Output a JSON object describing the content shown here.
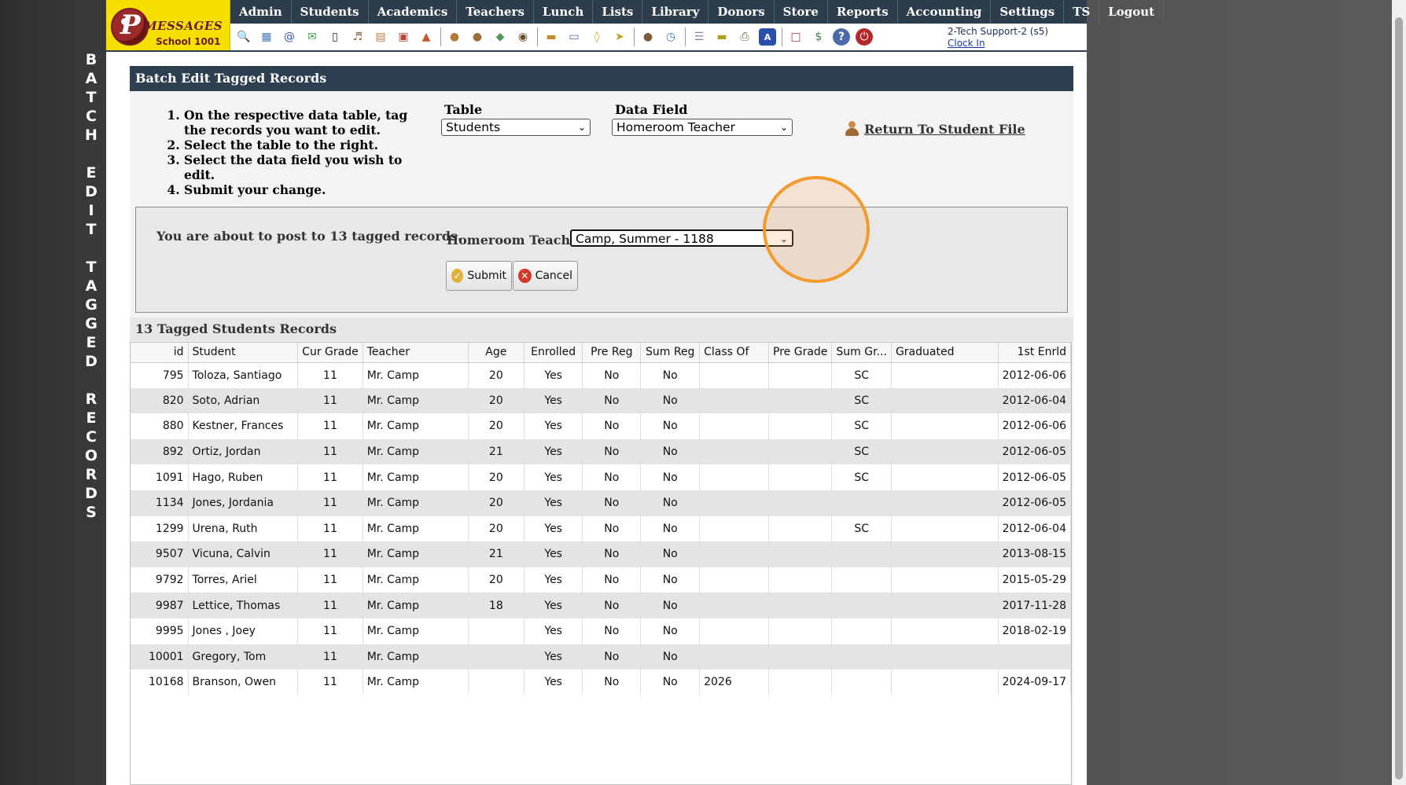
{
  "vertical_title": [
    "B",
    "A",
    "T",
    "C",
    "H",
    "",
    "E",
    "D",
    "I",
    "T",
    "",
    "T",
    "A",
    "G",
    "G",
    "E",
    "D",
    "",
    "R",
    "E",
    "C",
    "O",
    "R",
    "D",
    "S"
  ],
  "logo": {
    "name": "MESSAGES",
    "school": "School 1001"
  },
  "menu": [
    "Admin",
    "Students",
    "Academics",
    "Teachers",
    "Lunch",
    "Lists",
    "Library",
    "Donors",
    "Store",
    "Reports",
    "Accounting",
    "Settings",
    "TS",
    "Logout"
  ],
  "icons": [
    "search-icon",
    "calendar-grid-icon",
    "email-icon",
    "chat-icon",
    "phone-icon",
    "speaker-icon",
    "form-icon",
    "calendar-icon",
    "megaphone-icon",
    "separator",
    "student-icon",
    "teacher-icon",
    "tag-icon",
    "group-icon",
    "separator",
    "lunch-icon",
    "book-icon",
    "bell-icon",
    "donate-icon",
    "separator",
    "user-icon",
    "clock-icon",
    "separator",
    "list-icon",
    "id-card-icon",
    "printer-icon",
    "ap-icon",
    "separator",
    "pdf-icon",
    "money-icon",
    "help-icon",
    "power-icon"
  ],
  "user": {
    "name": "2-Tech Support-2 (s5)",
    "clock_in": "Clock In"
  },
  "panel": {
    "title": "Batch Edit Tagged Records",
    "instructions": [
      "On the respective data table, tag the records you want to edit.",
      "Select the table to the right.",
      "Select the data field you wish to edit.",
      "Submit your change."
    ],
    "table_label": "Table",
    "table_value": "Students",
    "data_field_label": "Data Field",
    "data_field_value": "Homeroom Teacher",
    "return_link": "Return To Student File"
  },
  "post": {
    "message": "You are about to post to 13 tagged records.",
    "field_label": "Homeroom Teacher",
    "field_value": "Camp, Summer - 1188",
    "submit": "Submit",
    "cancel": "Cancel"
  },
  "grid": {
    "title": "13 Tagged Students Records",
    "columns": [
      "id",
      "Student",
      "Cur Grade",
      "Teacher",
      "Age",
      "Enrolled",
      "Pre Reg",
      "Sum Reg",
      "Class Of",
      "Pre Grade",
      "Sum Gr...",
      "Graduated",
      "1st Enrld"
    ],
    "rows": [
      [
        "795",
        "Toloza, Santiago",
        "11",
        "Mr. Camp",
        "20",
        "Yes",
        "No",
        "No",
        "",
        "",
        "SC",
        "",
        "2012-06-06"
      ],
      [
        "820",
        "Soto, Adrian",
        "11",
        "Mr. Camp",
        "20",
        "Yes",
        "No",
        "No",
        "",
        "",
        "SC",
        "",
        "2012-06-04"
      ],
      [
        "880",
        "Kestner, Frances",
        "11",
        "Mr. Camp",
        "20",
        "Yes",
        "No",
        "No",
        "",
        "",
        "SC",
        "",
        "2012-06-06"
      ],
      [
        "892",
        "Ortiz, Jordan",
        "11",
        "Mr. Camp",
        "21",
        "Yes",
        "No",
        "No",
        "",
        "",
        "SC",
        "",
        "2012-06-05"
      ],
      [
        "1091",
        "Hago, Ruben",
        "11",
        "Mr. Camp",
        "20",
        "Yes",
        "No",
        "No",
        "",
        "",
        "SC",
        "",
        "2012-06-05"
      ],
      [
        "1134",
        "Jones, Jordania",
        "11",
        "Mr. Camp",
        "20",
        "Yes",
        "No",
        "No",
        "",
        "",
        "",
        "",
        "2012-06-05"
      ],
      [
        "1299",
        "Urena, Ruth",
        "11",
        "Mr. Camp",
        "20",
        "Yes",
        "No",
        "No",
        "",
        "",
        "SC",
        "",
        "2012-06-04"
      ],
      [
        "9507",
        "Vicuna, Calvin",
        "11",
        "Mr. Camp",
        "21",
        "Yes",
        "No",
        "No",
        "",
        "",
        "",
        "",
        "2013-08-15"
      ],
      [
        "9792",
        "Torres, Ariel",
        "11",
        "Mr. Camp",
        "20",
        "Yes",
        "No",
        "No",
        "",
        "",
        "",
        "",
        "2015-05-29"
      ],
      [
        "9987",
        "Lettice, Thomas",
        "11",
        "Mr. Camp",
        "18",
        "Yes",
        "No",
        "No",
        "",
        "",
        "",
        "",
        "2017-11-28"
      ],
      [
        "9995",
        "Jones , Joey",
        "11",
        "Mr. Camp",
        "",
        "Yes",
        "No",
        "No",
        "",
        "",
        "",
        "",
        "2018-02-19"
      ],
      [
        "10001",
        "Gregory, Tom",
        "11",
        "Mr. Camp",
        "",
        "Yes",
        "No",
        "No",
        "",
        "",
        "",
        "",
        ""
      ],
      [
        "10168",
        "Branson, Owen",
        "11",
        "Mr. Camp",
        "",
        "Yes",
        "No",
        "No",
        "2026",
        "",
        "",
        "",
        "2024-09-17"
      ]
    ]
  },
  "colors": {
    "header": "#2d3d4e",
    "logo_bg": "#f5e000",
    "cursor_ring": "#f39a2c"
  }
}
